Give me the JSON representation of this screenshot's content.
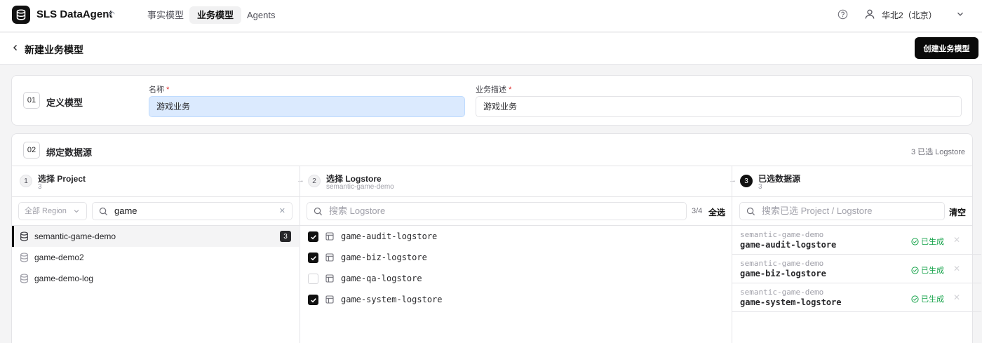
{
  "app": {
    "name": "SLS DataAgent",
    "nav": [
      "事实模型",
      "业务模型",
      "Agents"
    ],
    "region": "华北2（北京）"
  },
  "page": {
    "title": "新建业务模型",
    "create_button": "创建业务模型"
  },
  "step1": {
    "number": "01",
    "label": "定义模型",
    "name_label": "名称",
    "name_value": "游戏业务",
    "desc_label": "业务描述",
    "desc_value": "游戏业务",
    "required": "*"
  },
  "step2": {
    "number": "02",
    "label": "绑定数据源",
    "selected_count": "3 已选 Logstore",
    "col1": {
      "num": "1",
      "title": "选择 Project",
      "subtitle": "3",
      "region_placeholder": "全部 Region",
      "search_value": "game",
      "projects": [
        {
          "name": "semantic-game-demo",
          "badge": "3"
        },
        {
          "name": "game-demo2"
        },
        {
          "name": "game-demo-log"
        }
      ]
    },
    "col2": {
      "num": "2",
      "title": "选择 Logstore",
      "subtitle": "semantic-game-demo",
      "search_placeholder": "搜索 Logstore",
      "fraction": "3/4",
      "select_all": "全选",
      "logstores": [
        {
          "name": "game-audit-logstore",
          "checked": true
        },
        {
          "name": "game-biz-logstore",
          "checked": true
        },
        {
          "name": "game-qa-logstore",
          "checked": false
        },
        {
          "name": "game-system-logstore",
          "checked": true
        }
      ]
    },
    "col3": {
      "num": "3",
      "title": "已选数据源",
      "subtitle": "3",
      "search_placeholder": "搜索已选 Project / Logstore",
      "clear": "清空",
      "items": [
        {
          "project": "semantic-game-demo",
          "logstore": "game-audit-logstore",
          "status": "已生成"
        },
        {
          "project": "semantic-game-demo",
          "logstore": "game-biz-logstore",
          "status": "已生成"
        },
        {
          "project": "semantic-game-demo",
          "logstore": "game-system-logstore",
          "status": "已生成"
        }
      ]
    }
  }
}
